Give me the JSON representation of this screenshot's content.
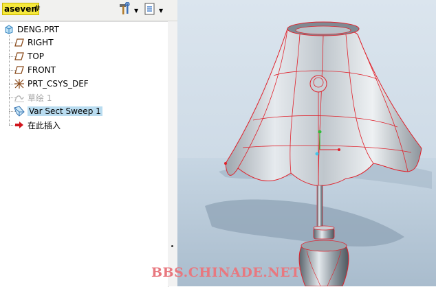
{
  "toolbar": {
    "logo_text": "aseven",
    "cursor_glyph": "#",
    "tools_icon": "hammer-wrench-icon",
    "show_icon": "document-list-icon"
  },
  "model_tree": {
    "root": {
      "label": "DENG.PRT",
      "icon": "part-icon"
    },
    "items": [
      {
        "label": "RIGHT",
        "icon": "datum-plane-icon",
        "state": "normal"
      },
      {
        "label": "TOP",
        "icon": "datum-plane-icon",
        "state": "normal"
      },
      {
        "label": "FRONT",
        "icon": "datum-plane-icon",
        "state": "normal"
      },
      {
        "label": "PRT_CSYS_DEF",
        "icon": "coordinate-system-icon",
        "state": "normal"
      },
      {
        "label": "草绘 1",
        "icon": "sketch-icon",
        "state": "suppressed"
      },
      {
        "label": "Var Sect Sweep 1",
        "icon": "sweep-feature-icon",
        "state": "selected"
      },
      {
        "label": "在此插入",
        "icon": "insert-arrow-icon",
        "state": "normal"
      }
    ]
  },
  "viewport": {
    "watermark": "BBS.CHINADE.NET",
    "accent_color": "#e0202a"
  }
}
